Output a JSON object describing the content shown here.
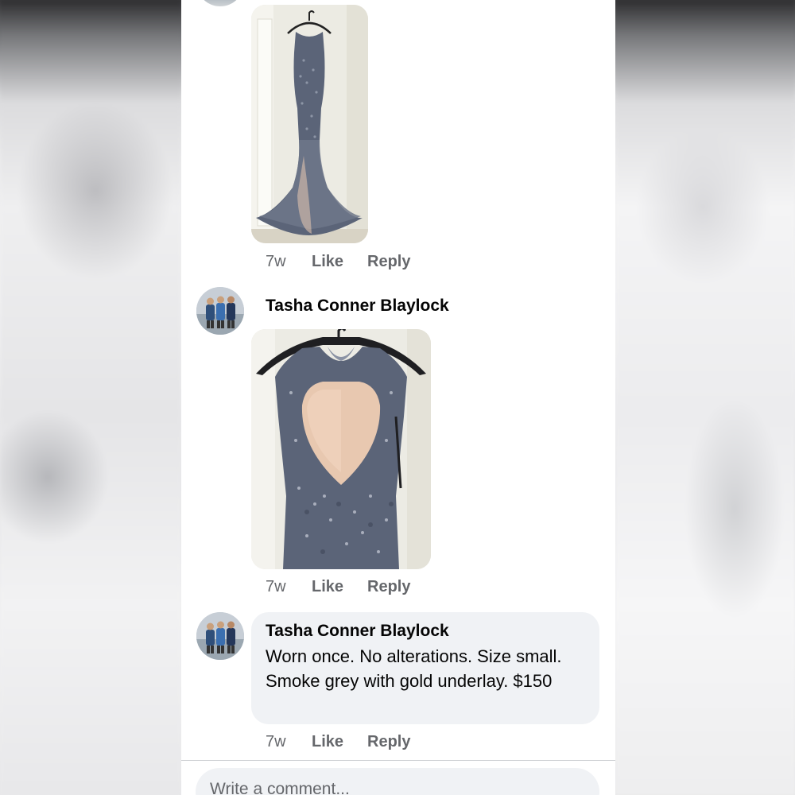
{
  "comments": [
    {
      "time": "7w",
      "like_label": "Like",
      "reply_label": "Reply"
    },
    {
      "author": "Tasha Conner Blaylock",
      "time": "7w",
      "like_label": "Like",
      "reply_label": "Reply"
    },
    {
      "author": "Tasha Conner Blaylock",
      "text": "Worn once. No alterations. Size small. Smoke grey with gold underlay. $150",
      "time": "7w",
      "like_label": "Like",
      "reply_label": "Reply"
    }
  ],
  "composer": {
    "placeholder": "Write a comment..."
  },
  "colors": {
    "name_text": "#050505",
    "meta_text": "#65676b",
    "bubble_bg": "#f0f2f5",
    "dress_color": "#5b6478",
    "underlay_color": "#e8c8b0"
  }
}
